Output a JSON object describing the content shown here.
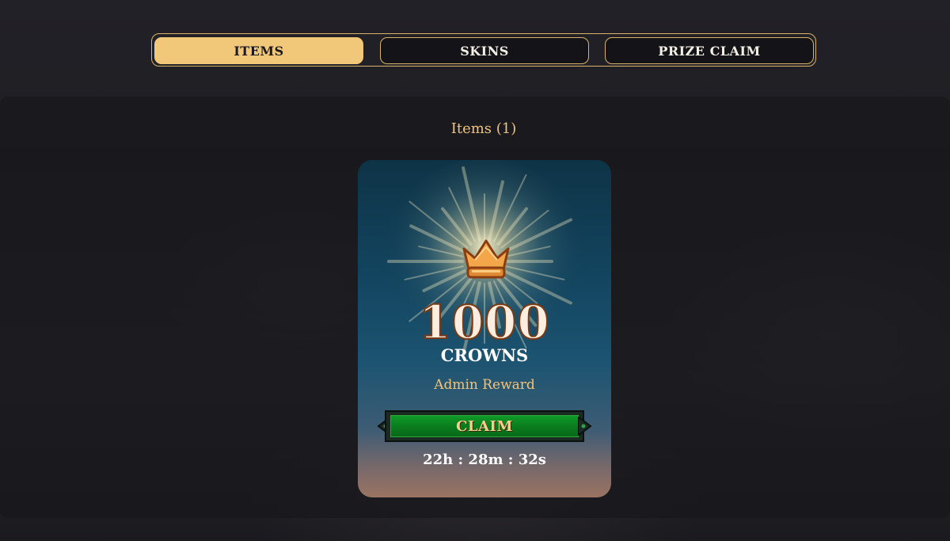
{
  "tabs": [
    {
      "label": "ITEMS",
      "active": true
    },
    {
      "label": "SKINS",
      "active": false
    },
    {
      "label": "PRIZE CLAIM",
      "active": false
    }
  ],
  "section": {
    "title": "Items (1)"
  },
  "card": {
    "icon": "crown-icon",
    "amount": "1000",
    "currency": "CROWNS",
    "source": "Admin Reward",
    "claim_label": "CLAIM",
    "timer": "22h : 28m : 32s"
  },
  "colors": {
    "accent": "#f1c77a",
    "tab_border": "#d9b36a",
    "claim_green": "#0b8a22",
    "card_top": "#0e3346"
  }
}
